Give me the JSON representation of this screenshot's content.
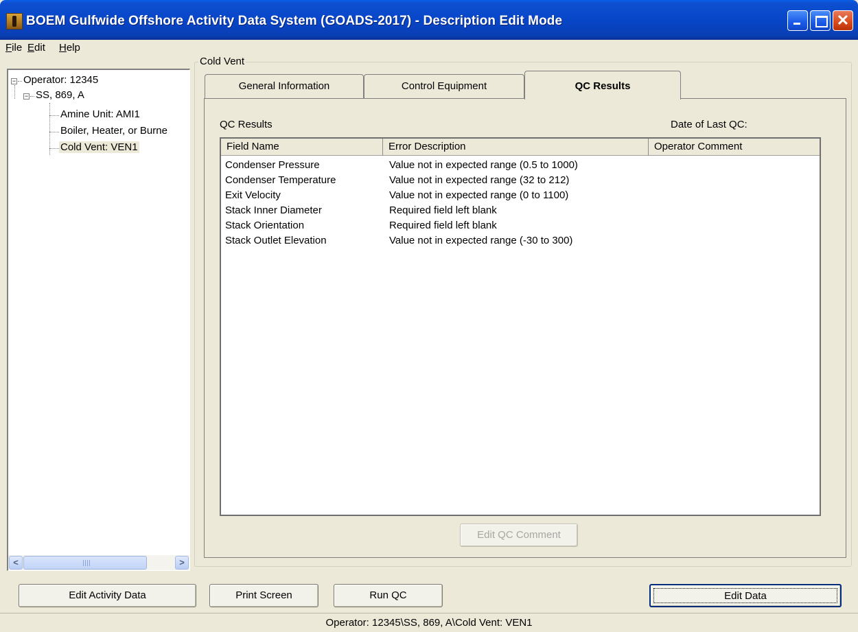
{
  "window": {
    "title": "BOEM Gulfwide Offshore Activity Data System (GOADS-2017) - Description Edit Mode",
    "close_glyph": "✕"
  },
  "menu": [
    "File",
    "Edit",
    "Help"
  ],
  "tree": {
    "root": "Operator: 12345",
    "platform": "SS, 869, A",
    "children": [
      "Amine Unit: AMI1",
      "Boiler, Heater, or Burne",
      "Cold Vent: VEN1"
    ],
    "expander_glyph": "−",
    "scroll_left": "<",
    "scroll_right": ">"
  },
  "group": {
    "label": "Cold Vent"
  },
  "tabs": [
    "General Information",
    "Control Equipment",
    "QC Results"
  ],
  "active_tab": "QC Results",
  "panel": {
    "qc_label": "QC Results",
    "date_label": "Date of Last QC:"
  },
  "table": {
    "columns": [
      "Field Name",
      "Error Description",
      "Operator Comment"
    ],
    "rows": [
      {
        "field": "Condenser Pressure",
        "error": "Value not in expected range (0.5 to 1000)",
        "comment": ""
      },
      {
        "field": "Condenser Temperature",
        "error": "Value not in expected range (32 to 212)",
        "comment": ""
      },
      {
        "field": "Exit Velocity",
        "error": "Value not in expected range (0 to 1100)",
        "comment": ""
      },
      {
        "field": "Stack Inner Diameter",
        "error": "Required field left blank",
        "comment": ""
      },
      {
        "field": "Stack Orientation",
        "error": "Required field left blank",
        "comment": ""
      },
      {
        "field": "Stack Outlet Elevation",
        "error": "Value not in expected range (-30 to 300)",
        "comment": ""
      }
    ]
  },
  "buttons": {
    "edit_qc_comment": "Edit QC Comment",
    "edit_activity_data": "Edit Activity Data",
    "print_screen": "Print Screen",
    "run_qc": "Run QC",
    "edit_data": "Edit Data"
  },
  "status": "Operator: 12345\\SS, 869, A\\Cold Vent: VEN1"
}
